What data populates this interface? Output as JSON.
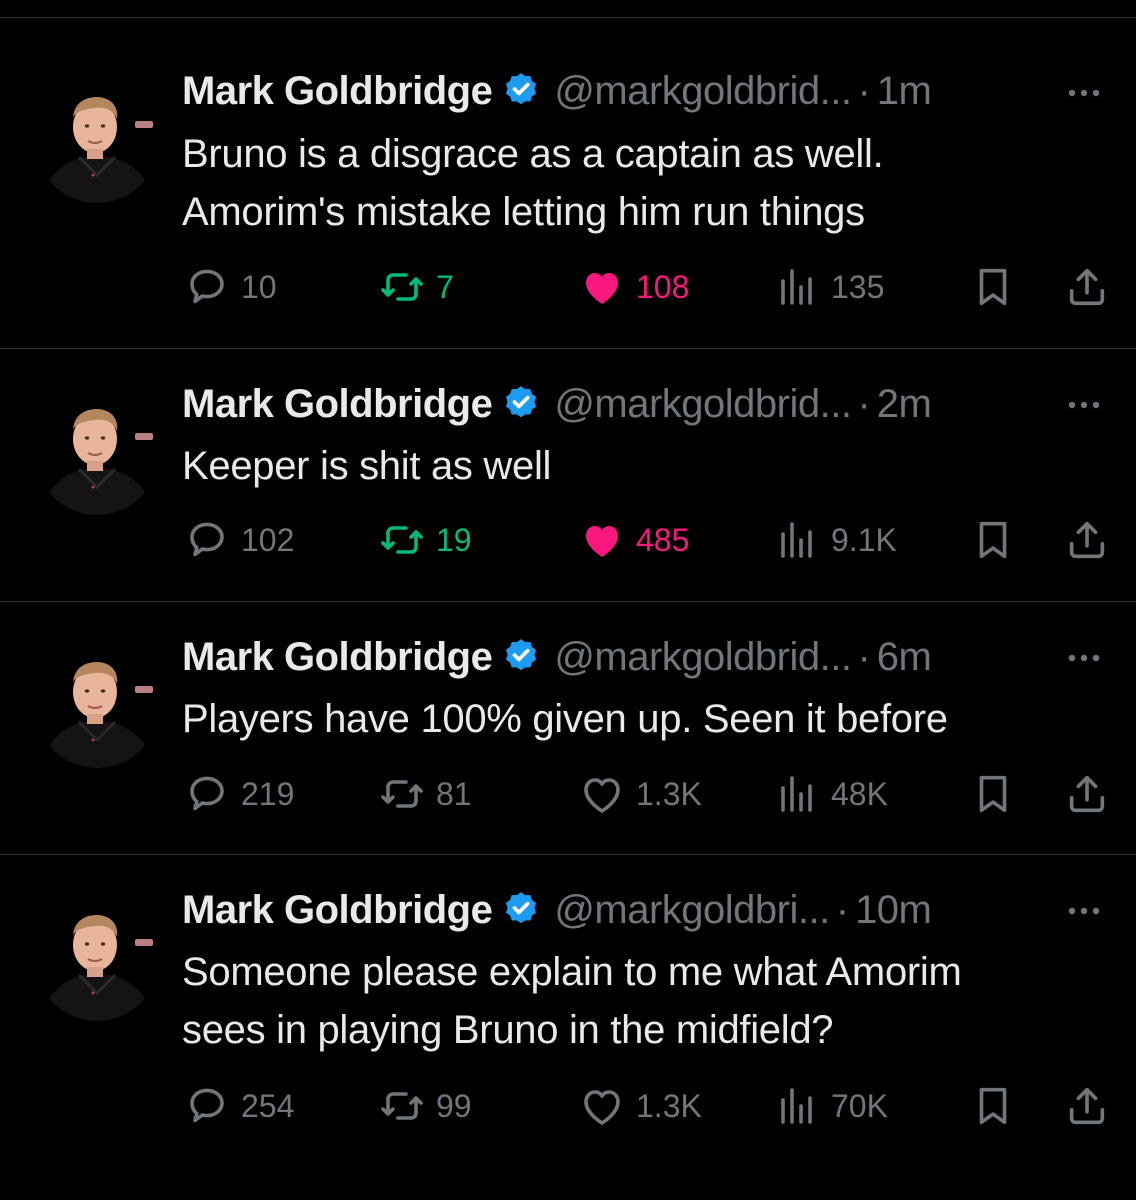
{
  "colors": {
    "background": "#000000",
    "text": "#e7e9ea",
    "muted": "#71767b",
    "verified": "#1d9bf0",
    "retweet_green": "#00ba7c",
    "like_pink": "#f91880",
    "divider": "#2f3336"
  },
  "tweets": [
    {
      "name": "Mark Goldbridge",
      "handle": "@markgoldbrid...",
      "separator": "·",
      "time": "1m",
      "lines": [
        "Bruno is a disgrace as a captain as well.",
        "Amorim's mistake letting him run things"
      ],
      "replies": "10",
      "retweets": "7",
      "likes": "108",
      "views": "135",
      "retweeted": true,
      "liked": true
    },
    {
      "name": "Mark Goldbridge",
      "handle": "@markgoldbrid...",
      "separator": "·",
      "time": "2m",
      "lines": [
        "Keeper is shit as well"
      ],
      "replies": "102",
      "retweets": "19",
      "likes": "485",
      "views": "9.1K",
      "retweeted": true,
      "liked": true
    },
    {
      "name": "Mark Goldbridge",
      "handle": "@markgoldbrid...",
      "separator": "·",
      "time": "6m",
      "lines": [
        "Players have 100% given up. Seen it before"
      ],
      "replies": "219",
      "retweets": "81",
      "likes": "1.3K",
      "views": "48K",
      "retweeted": false,
      "liked": false
    },
    {
      "name": "Mark Goldbridge",
      "handle": "@markgoldbri...",
      "separator": "·",
      "time": "10m",
      "lines": [
        "Someone please explain to me what Amorim",
        "sees in playing Bruno in the midfield?"
      ],
      "replies": "254",
      "retweets": "99",
      "likes": "1.3K",
      "views": "70K",
      "retweeted": false,
      "liked": false
    }
  ],
  "icons": {
    "reply": "reply-icon",
    "retweet": "retweet-icon",
    "like": "heart-icon",
    "views": "views-chart-icon",
    "bookmark": "bookmark-icon",
    "share": "share-icon",
    "more": "more-options-icon",
    "verified": "verified-badge-icon"
  }
}
